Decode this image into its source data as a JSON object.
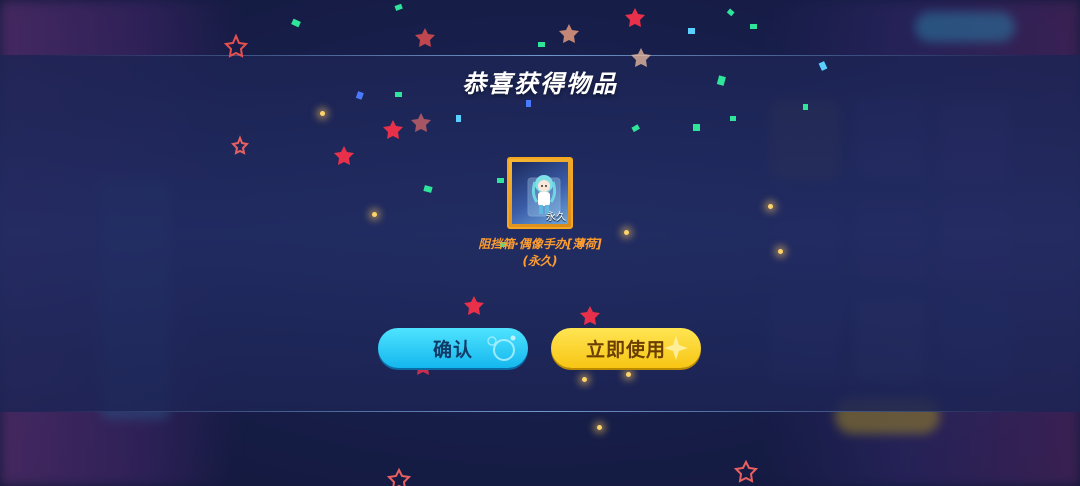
{
  "dialog": {
    "title": "恭喜获得物品"
  },
  "reward": {
    "tag": "永久",
    "name_line1": "阻挡箱·偶像手办[薄荷]",
    "name_line2": "(永久)",
    "icon": "mint-idol-figure-box-icon"
  },
  "buttons": {
    "confirm_label": "确认",
    "use_now_label": "立即使用"
  },
  "colors": {
    "title": "#ffffff",
    "item_name": "#ff9d2e",
    "confirm_button": "#14b7ee",
    "use_button": "#f7c514",
    "item_frame": "#f5a623"
  }
}
